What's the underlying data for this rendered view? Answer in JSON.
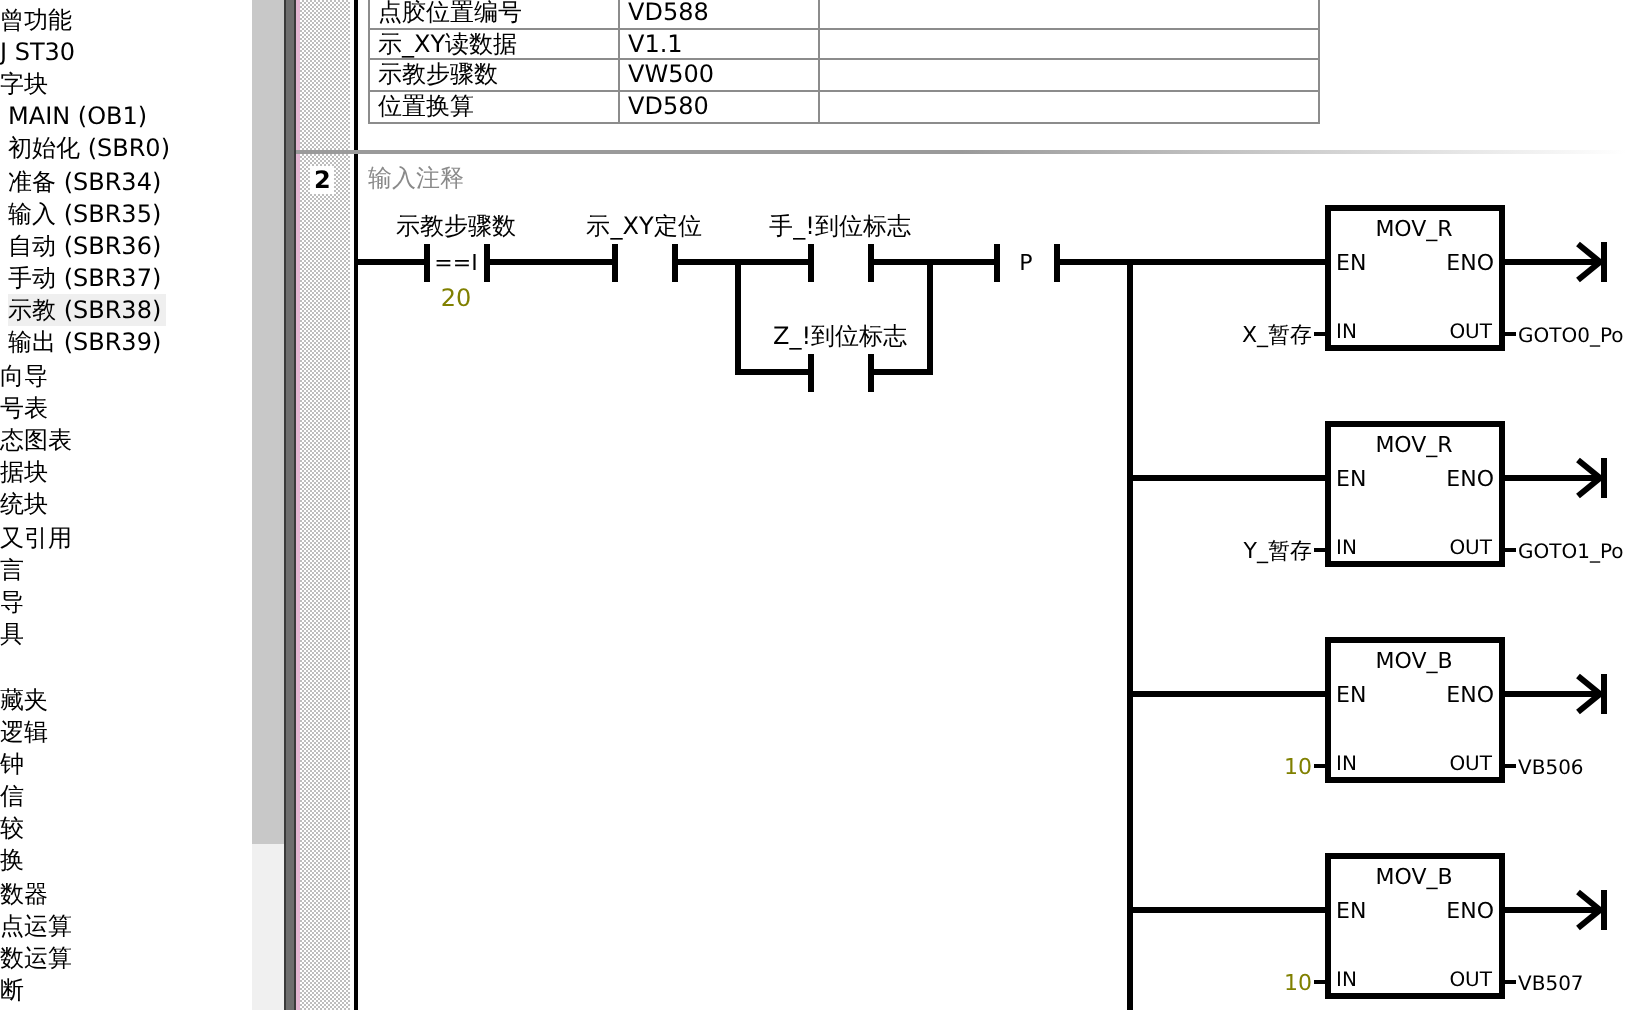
{
  "tree": {
    "items": [
      {
        "label": "曾功能",
        "selected": false
      },
      {
        "label": "J ST30",
        "selected": false
      },
      {
        "label": "字块",
        "selected": false,
        "children": [
          {
            "label": "MAIN (OB1)",
            "selected": false
          },
          {
            "label": "初始化 (SBR0)",
            "selected": false
          },
          {
            "label": "准备 (SBR34)",
            "selected": false
          },
          {
            "label": "输入 (SBR35)",
            "selected": false
          },
          {
            "label": "自动 (SBR36)",
            "selected": false
          },
          {
            "label": "手动 (SBR37)",
            "selected": false
          },
          {
            "label": "示教 (SBR38)",
            "selected": true
          },
          {
            "label": "输出 (SBR39)",
            "selected": false
          }
        ]
      },
      {
        "label": "向导",
        "selected": false
      },
      {
        "label": "号表",
        "selected": false
      },
      {
        "label": "态图表",
        "selected": false
      },
      {
        "label": "据块",
        "selected": false
      },
      {
        "label": "统块",
        "selected": false
      },
      {
        "label": "又引用",
        "selected": false
      },
      {
        "label": "言",
        "selected": false
      },
      {
        "label": "导",
        "selected": false
      },
      {
        "label": "具",
        "selected": false
      },
      {
        "label": "藏夹",
        "selected": false,
        "gap_before": true
      },
      {
        "label": "逻辑",
        "selected": false
      },
      {
        "label": "钟",
        "selected": false
      },
      {
        "label": "信",
        "selected": false
      },
      {
        "label": "较",
        "selected": false
      },
      {
        "label": "换",
        "selected": false
      },
      {
        "label": "数器",
        "selected": false
      },
      {
        "label": "点运算",
        "selected": false
      },
      {
        "label": "数运算",
        "selected": false
      },
      {
        "label": "断",
        "selected": false
      }
    ]
  },
  "symbol_table": {
    "rows": [
      {
        "symbol": "点胶位置编号",
        "address": "VD588"
      },
      {
        "symbol": "示_XY读数据",
        "address": "V1.1"
      },
      {
        "symbol": "示教步骤数",
        "address": "VW500"
      },
      {
        "symbol": "位置换算",
        "address": "VD580"
      }
    ]
  },
  "network": {
    "number": "2",
    "comment": "输入注释",
    "contacts": [
      {
        "kind": "compare",
        "label": "示教步骤数",
        "operator": "==I",
        "operand": "20"
      },
      {
        "kind": "normal",
        "label": "示_XY定位"
      },
      {
        "kind": "normal",
        "label": "手_!到位标志"
      },
      {
        "kind": "parallel",
        "label": "Z_!到位标志"
      },
      {
        "kind": "pulse",
        "label": "P"
      }
    ],
    "blocks": [
      {
        "title": "MOV_R",
        "en": "EN",
        "eno": "ENO",
        "in_pin": "IN",
        "out_pin": "OUT",
        "input": "X_暂存",
        "input_constant": false,
        "output": "GOTO0_Po"
      },
      {
        "title": "MOV_R",
        "en": "EN",
        "eno": "ENO",
        "in_pin": "IN",
        "out_pin": "OUT",
        "input": "Y_暂存",
        "input_constant": false,
        "output": "GOTO1_Po"
      },
      {
        "title": "MOV_B",
        "en": "EN",
        "eno": "ENO",
        "in_pin": "IN",
        "out_pin": "OUT",
        "input": "10",
        "input_constant": true,
        "output": "VB506"
      },
      {
        "title": "MOV_B",
        "en": "EN",
        "eno": "ENO",
        "in_pin": "IN",
        "out_pin": "OUT",
        "input": "10",
        "input_constant": true,
        "output": "VB507"
      }
    ]
  }
}
